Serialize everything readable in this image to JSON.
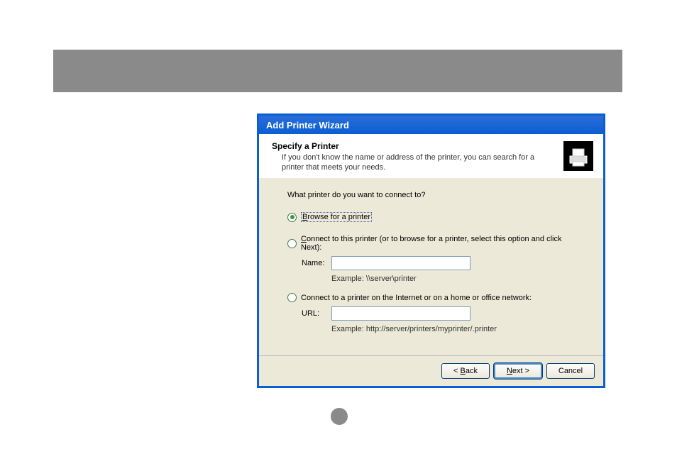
{
  "dialog": {
    "title": "Add Printer Wizard",
    "header": {
      "title": "Specify a Printer",
      "subtitle": "If you don't know the name or address of the printer, you can search for a printer that meets your needs."
    },
    "question": "What printer do you want to connect to?",
    "options": {
      "browse": {
        "prefix": "B",
        "rest": "rowse for a printer"
      },
      "connect_name": {
        "prefix": "C",
        "rest": "onnect to this printer (or to browse for a printer, select this option and click Next):"
      },
      "connect_url": {
        "text": "Connect to a printer on the Internet or on a home or office network:"
      }
    },
    "fields": {
      "name_label": "Name:",
      "name_value": "",
      "name_example": "Example: \\\\server\\printer",
      "url_label": "URL:",
      "url_value": "",
      "url_example": "Example: http://server/printers/myprinter/.printer"
    },
    "buttons": {
      "back_prefix": "< ",
      "back_u": "B",
      "back_rest": "ack",
      "next_u": "N",
      "next_rest": "ext >",
      "cancel": "Cancel"
    }
  }
}
